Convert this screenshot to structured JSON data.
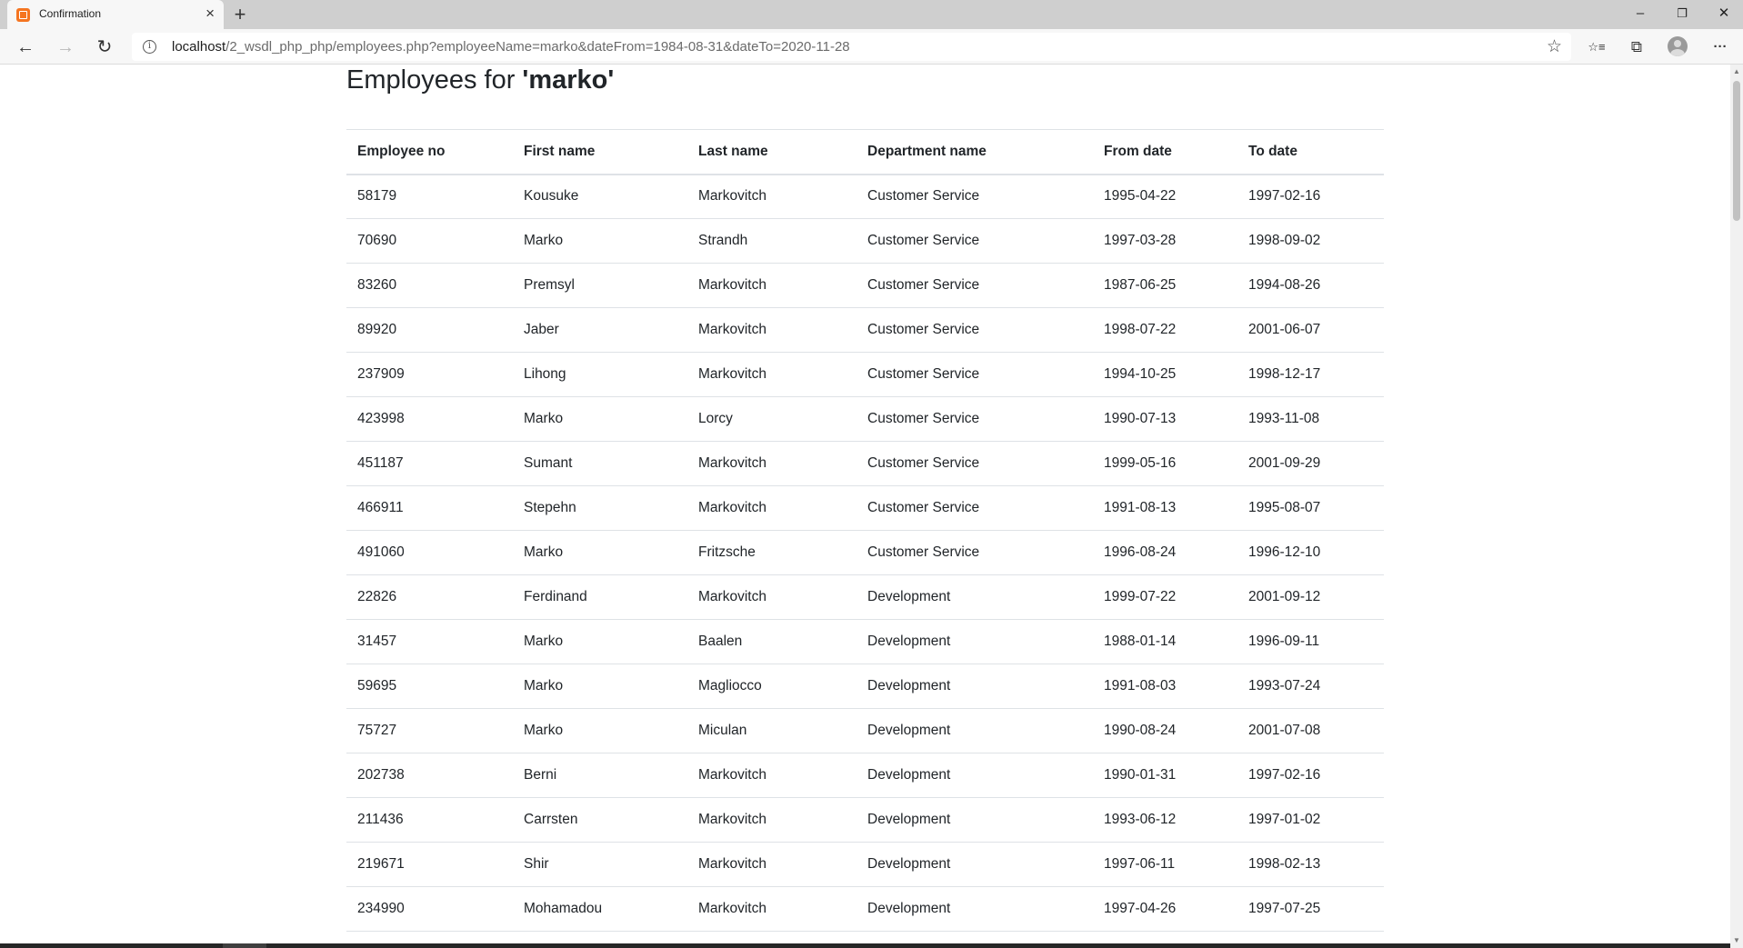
{
  "browser": {
    "tab_title": "Confirmation",
    "tab_close": "×",
    "new_tab": "+",
    "window_controls": {
      "minimize": "–",
      "restore": "❐",
      "close": "✕"
    },
    "nav": {
      "back": "←",
      "forward": "→",
      "reload": "↻"
    },
    "url_host": "localhost",
    "url_path": "/2_wsdl_php_php/employees.php?employeeName=marko&dateFrom=1984-08-31&dateTo=2020-11-28",
    "info_glyph": "i",
    "star_glyph": "☆",
    "toolbar_icons": {
      "favorites": "☆≡",
      "collections": "⧉",
      "more": "···"
    }
  },
  "page": {
    "title_prefix": "Employees for ",
    "title_name": "'marko'"
  },
  "table": {
    "headers": [
      "Employee no",
      "First name",
      "Last name",
      "Department name",
      "From date",
      "To date"
    ],
    "rows": [
      [
        "58179",
        "Kousuke",
        "Markovitch",
        "Customer Service",
        "1995-04-22",
        "1997-02-16"
      ],
      [
        "70690",
        "Marko",
        "Strandh",
        "Customer Service",
        "1997-03-28",
        "1998-09-02"
      ],
      [
        "83260",
        "Premsyl",
        "Markovitch",
        "Customer Service",
        "1987-06-25",
        "1994-08-26"
      ],
      [
        "89920",
        "Jaber",
        "Markovitch",
        "Customer Service",
        "1998-07-22",
        "2001-06-07"
      ],
      [
        "237909",
        "Lihong",
        "Markovitch",
        "Customer Service",
        "1994-10-25",
        "1998-12-17"
      ],
      [
        "423998",
        "Marko",
        "Lorcy",
        "Customer Service",
        "1990-07-13",
        "1993-11-08"
      ],
      [
        "451187",
        "Sumant",
        "Markovitch",
        "Customer Service",
        "1999-05-16",
        "2001-09-29"
      ],
      [
        "466911",
        "Stepehn",
        "Markovitch",
        "Customer Service",
        "1991-08-13",
        "1995-08-07"
      ],
      [
        "491060",
        "Marko",
        "Fritzsche",
        "Customer Service",
        "1996-08-24",
        "1996-12-10"
      ],
      [
        "22826",
        "Ferdinand",
        "Markovitch",
        "Development",
        "1999-07-22",
        "2001-09-12"
      ],
      [
        "31457",
        "Marko",
        "Baalen",
        "Development",
        "1988-01-14",
        "1996-09-11"
      ],
      [
        "59695",
        "Marko",
        "Magliocco",
        "Development",
        "1991-08-03",
        "1993-07-24"
      ],
      [
        "75727",
        "Marko",
        "Miculan",
        "Development",
        "1990-08-24",
        "2001-07-08"
      ],
      [
        "202738",
        "Berni",
        "Markovitch",
        "Development",
        "1990-01-31",
        "1997-02-16"
      ],
      [
        "211436",
        "Carrsten",
        "Markovitch",
        "Development",
        "1993-06-12",
        "1997-01-02"
      ],
      [
        "219671",
        "Shir",
        "Markovitch",
        "Development",
        "1997-06-11",
        "1998-02-13"
      ],
      [
        "234990",
        "Mohamadou",
        "Markovitch",
        "Development",
        "1997-04-26",
        "1997-07-25"
      ]
    ]
  }
}
